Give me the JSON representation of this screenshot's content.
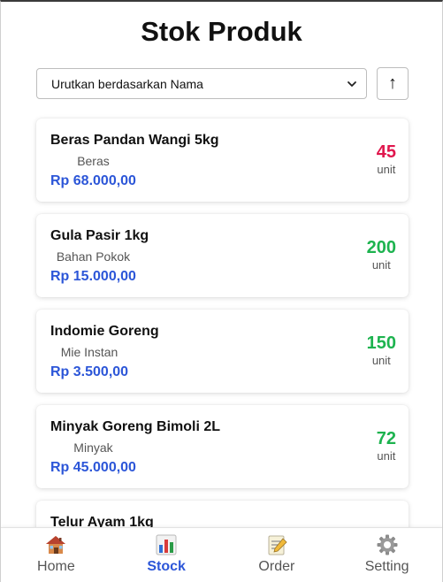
{
  "page": {
    "title": "Stok Produk"
  },
  "sort": {
    "selected_label": "Urutkan berdasarkan Nama",
    "order_icon": "arrow-up-icon",
    "order_symbol": "↑"
  },
  "colors": {
    "low_stock": "#e0174d",
    "ok_stock": "#1db34f",
    "price": "#2c56d8",
    "active_nav": "#2c56d8"
  },
  "products": [
    {
      "name": "Beras Pandan Wangi 5kg",
      "category": "Beras",
      "price": "Rp 68.000,00",
      "qty": "45",
      "unit": "unit",
      "status": "low"
    },
    {
      "name": "Gula Pasir 1kg",
      "category": "Bahan Pokok",
      "price": "Rp 15.000,00",
      "qty": "200",
      "unit": "unit",
      "status": "ok"
    },
    {
      "name": "Indomie Goreng",
      "category": "Mie Instan",
      "price": "Rp 3.500,00",
      "qty": "150",
      "unit": "unit",
      "status": "ok"
    },
    {
      "name": "Minyak Goreng Bimoli 2L",
      "category": "Minyak",
      "price": "Rp 45.000,00",
      "qty": "72",
      "unit": "unit",
      "status": "ok"
    },
    {
      "name": "Telur Ayam 1kg",
      "category": "",
      "price": "",
      "qty": "",
      "unit": "",
      "status": "ok"
    }
  ],
  "nav": {
    "items": [
      {
        "label": "Home",
        "icon": "house-icon",
        "active": false
      },
      {
        "label": "Stock",
        "icon": "bar-chart-icon",
        "active": true
      },
      {
        "label": "Order",
        "icon": "memo-icon",
        "active": false
      },
      {
        "label": "Setting",
        "icon": "gear-icon",
        "active": false
      }
    ]
  }
}
